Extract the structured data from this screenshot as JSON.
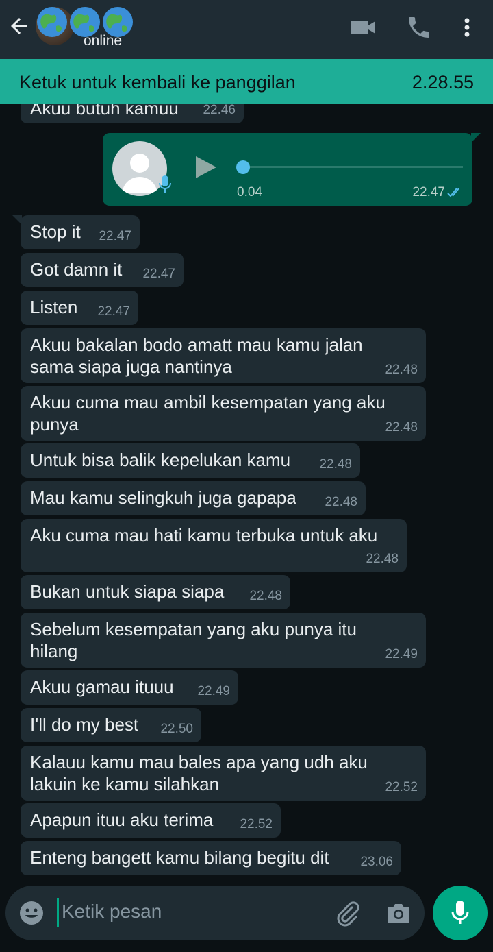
{
  "header": {
    "status": "online"
  },
  "call_banner": {
    "label": "Ketuk untuk kembali ke panggilan",
    "duration": "2.28.55"
  },
  "partial_message": {
    "text": "Akuu butuh kamuu",
    "time": "22.46"
  },
  "voice_note": {
    "duration": "0.04",
    "time": "22.47",
    "progress": 0
  },
  "messages": [
    {
      "text": "Stop it",
      "time": "22.47"
    },
    {
      "text": "Got damn it",
      "time": "22.47"
    },
    {
      "text": "Listen",
      "time": "22.47"
    },
    {
      "text": "Akuu bakalan bodo amatt mau kamu jalan sama siapa juga nantinya",
      "time": "22.48"
    },
    {
      "text": "Akuu cuma mau ambil kesempatan yang aku punya",
      "time": "22.48"
    },
    {
      "text": "Untuk bisa balik kepelukan kamu",
      "time": "22.48"
    },
    {
      "text": "Mau kamu selingkuh juga gapapa",
      "time": "22.48"
    },
    {
      "text": "Aku cuma mau hati kamu terbuka untuk aku",
      "time": "22.48"
    },
    {
      "text": "Bukan untuk siapa siapa",
      "time": "22.48"
    },
    {
      "text": "Sebelum kesempatan yang aku punya itu hilang",
      "time": "22.49"
    },
    {
      "text": "Akuu gamau ituuu",
      "time": "22.49"
    },
    {
      "text": "I'll do my best",
      "time": "22.50"
    },
    {
      "text": "Kalauu kamu mau bales apa yang udh aku lakuin ke kamu silahkan",
      "time": "22.52"
    },
    {
      "text": "Apapun ituu aku terima",
      "time": "22.52"
    },
    {
      "text": "Enteng bangett kamu bilang begitu dit",
      "time": "23.06"
    }
  ],
  "composer": {
    "placeholder": "Ketik pesan"
  },
  "icons": {
    "back": "arrow-left-icon",
    "video": "video-call-icon",
    "voice_call": "phone-icon",
    "menu": "more-vert-icon",
    "emoji": "emoji-icon",
    "attach": "paperclip-icon",
    "camera": "camera-icon",
    "mic": "mic-icon"
  },
  "colors": {
    "header_bg": "#1f2c34",
    "call_banner_bg": "#1eae97",
    "incoming_bubble": "#1f2c33",
    "outgoing_bubble": "#005c4b",
    "accent": "#00a884",
    "read_ticks": "#53bdeb"
  }
}
